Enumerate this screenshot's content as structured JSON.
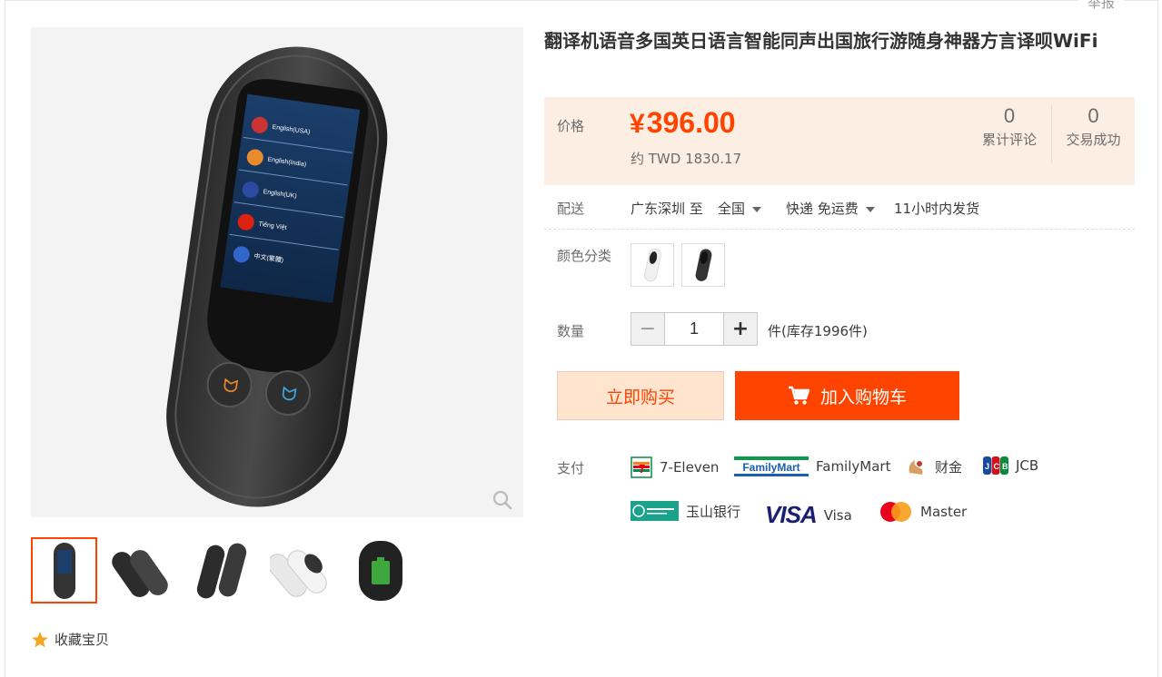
{
  "header": {
    "report_label": "举报"
  },
  "product": {
    "title": "翻译机语音多国英日语言智能同声出国旅行游随身神器方言译呗WiFi"
  },
  "price": {
    "label": "价格",
    "currency": "¥",
    "amount": "396.00",
    "approx": "约 TWD 1830.17",
    "stats": [
      {
        "count": "0",
        "label": "累计评论"
      },
      {
        "count": "0",
        "label": "交易成功"
      }
    ]
  },
  "delivery": {
    "label": "配送",
    "from": "广东深圳 至",
    "to": "全国",
    "method": "快递 免运费",
    "ship_time": "11小时内发货"
  },
  "color": {
    "label": "颜色分类",
    "options": [
      "white-device",
      "black-device"
    ]
  },
  "quantity": {
    "label": "数量",
    "minus": "−",
    "value": "1",
    "plus": "+",
    "stock_text": "件(库存1996件)"
  },
  "actions": {
    "buy_now": "立即购买",
    "add_to_cart": "加入购物车"
  },
  "payment": {
    "label": "支付",
    "methods": [
      {
        "name": "7-Eleven"
      },
      {
        "name": "FamilyMart",
        "logo_text": "FamilyMart"
      },
      {
        "name": "财金"
      },
      {
        "name": "JCB",
        "logo_text": "JCB"
      },
      {
        "name": "玉山银行"
      },
      {
        "name": "Visa",
        "logo_text": "VISA"
      },
      {
        "name": "Master"
      }
    ]
  },
  "favorite": {
    "label": "收藏宝贝"
  },
  "colors": {
    "accent": "#ff4400",
    "price_bg": "#fdeee3",
    "buy_now_bg": "#ffe4d0"
  }
}
